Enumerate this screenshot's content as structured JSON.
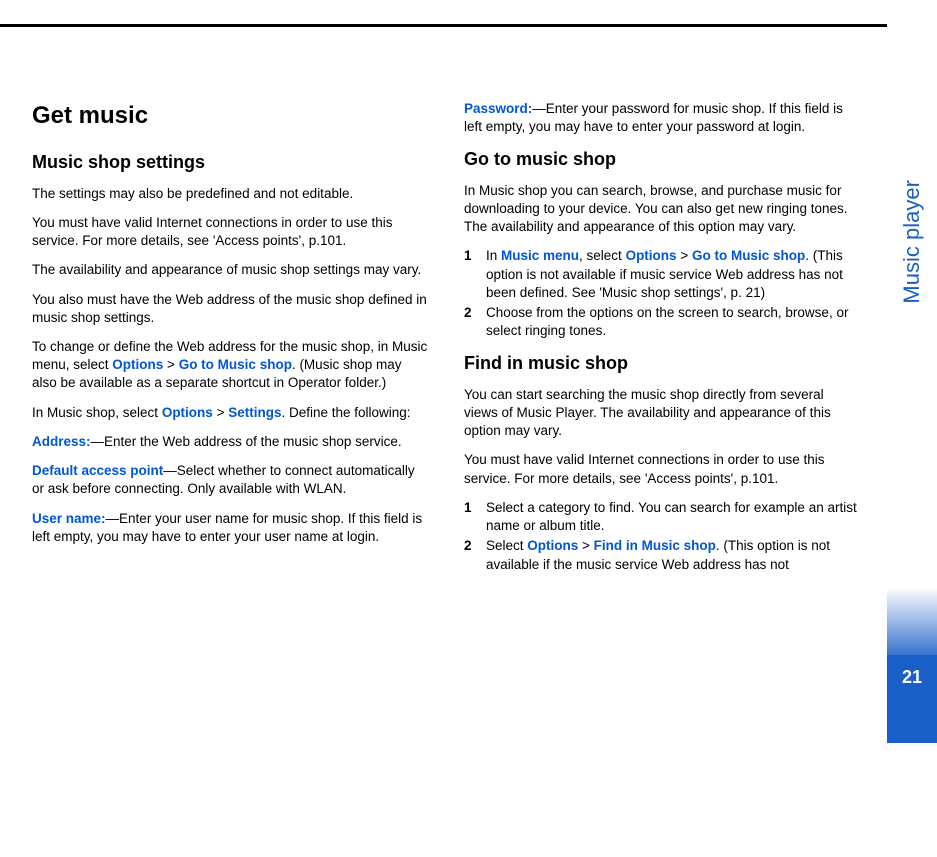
{
  "side": {
    "section": "Music player",
    "pagenum": "21"
  },
  "left": {
    "h1": "Get music",
    "h2a": "Music shop settings",
    "p1": "The settings may also be predefined and not editable.",
    "p2": "You must have valid Internet connections in order to use this service. For more details, see 'Access points', p.101.",
    "p3": "The availability and appearance of music shop settings may vary.",
    "p4": "You also must have the Web address of the music shop defined in music shop settings.",
    "p5a": "To change or define the Web address for the music shop, in Music menu, select ",
    "p5b": "Options",
    "p5c": " > ",
    "p5d": "Go to Music shop",
    "p5e": ". (Music shop may also be available as a separate shortcut in Operator folder.)",
    "p6a": "In Music shop, select ",
    "p6b": "Options",
    "p6c": " > ",
    "p6d": "Settings",
    "p6e": ". Define the following:",
    "addr_lbl": "Address:",
    "addr_txt": "—Enter the Web address of the music shop service.",
    "dap_lbl": "Default access point",
    "dap_txt": "—Select whether to connect automatically or ask before connecting. Only available with WLAN.",
    "user_lbl": "User name:",
    "user_txt": "—Enter your user name for music shop. If this field is left empty, you may have to enter your user name at login."
  },
  "right": {
    "pwd_lbl": "Password:",
    "pwd_txt": "—Enter your password for music shop. If this field is left empty, you may have to enter your password at login.",
    "h2b": "Go to music shop",
    "g1": "In Music shop you can search, browse, and purchase music for downloading to your device. You can also get new ringing tones. The availability and appearance of this option may vary.",
    "s1n": "1",
    "s1a": "In ",
    "s1b": "Music menu",
    "s1c": ", select ",
    "s1d": "Options",
    "s1e": " > ",
    "s1f": "Go to Music shop",
    "s1g": ". (This option is not available if music service Web address has not been defined. See 'Music shop settings', p. 21)",
    "s2n": "2",
    "s2t": "Choose from the options on the screen to search, browse, or select ringing tones.",
    "h2c": "Find in music shop",
    "f1": "You can start searching the music shop directly from several views of Music Player. The availability and appearance of this option may vary.",
    "f2": "You must have valid Internet connections in order to use this service. For more details,  see 'Access points', p.101.",
    "fs1n": "1",
    "fs1t": "Select a category to find. You can search for example an artist name or album title.",
    "fs2n": "2",
    "fs2a": "Select ",
    "fs2b": "Options",
    "fs2c": " > ",
    "fs2d": "Find in Music shop",
    "fs2e": ". (This option is not available if the music service Web address has not"
  }
}
